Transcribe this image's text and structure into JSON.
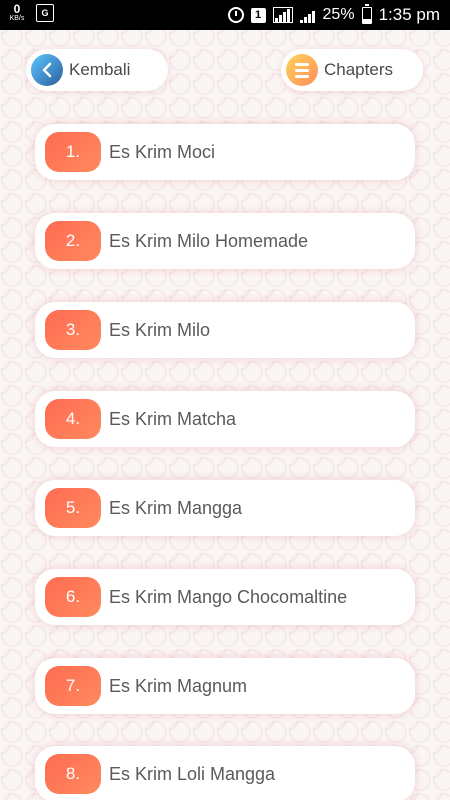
{
  "status_bar": {
    "net_speed_value": "0",
    "net_speed_unit": "KB/s",
    "notif_icon": "translate-icon",
    "sim_badge": "1",
    "battery_percent": "25%",
    "time": "1:35 pm"
  },
  "header": {
    "back_label": "Kembali",
    "chapters_label": "Chapters"
  },
  "colors": {
    "accent": "#ff6b52",
    "back_icon": "#3f8fd0",
    "chapters_icon": "#ffb35a"
  },
  "items": [
    {
      "number": "1.",
      "title": "Es Krim Moci"
    },
    {
      "number": "2.",
      "title": "Es Krim Milo Homemade"
    },
    {
      "number": "3.",
      "title": "Es Krim Milo"
    },
    {
      "number": "4.",
      "title": "Es Krim Matcha"
    },
    {
      "number": "5.",
      "title": "Es Krim Mangga"
    },
    {
      "number": "6.",
      "title": "Es Krim Mango Chocomaltine"
    },
    {
      "number": "7.",
      "title": "Es Krim Magnum"
    },
    {
      "number": "8.",
      "title": "Es Krim Loli Mangga"
    }
  ]
}
